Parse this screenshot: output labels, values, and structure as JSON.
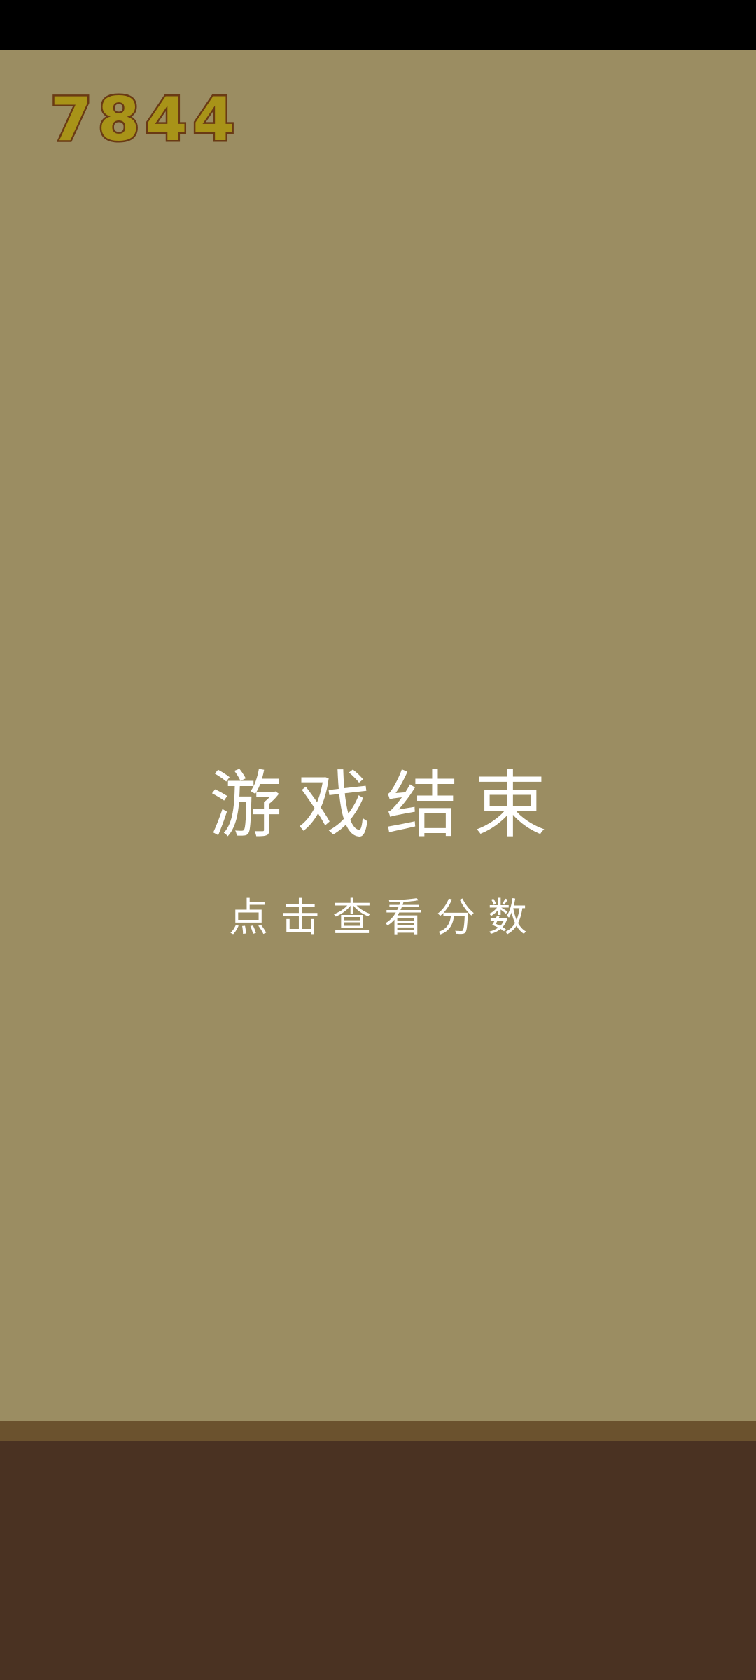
{
  "game": {
    "score": "7844",
    "title": "游戏结束",
    "hint": "点击查看分数"
  },
  "colors": {
    "sky": "#9b8d62",
    "ground_edge": "#6b522e",
    "ground": "#4a3222",
    "score_fill": "#a89318",
    "score_outline": "#6a3a14",
    "text": "#ffffff"
  }
}
